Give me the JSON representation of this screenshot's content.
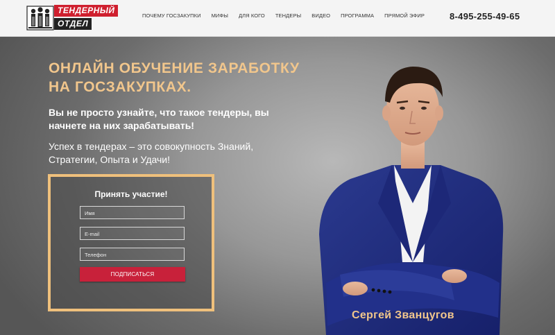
{
  "header": {
    "logo": {
      "line1": "ТЕНДЕРНЫЙ",
      "line2": "ОТДЕЛ",
      "icon": "people-building-icon"
    },
    "nav": [
      {
        "label": "ПОЧЕМУ ГОСЗАКУПКИ"
      },
      {
        "label": "МИФЫ"
      },
      {
        "label": "ДЛЯ КОГО"
      },
      {
        "label": "ТЕНДЕРЫ"
      },
      {
        "label": "ВИДЕО"
      },
      {
        "label": "ПРОГРАММА"
      },
      {
        "label": "ПРЯМОЙ ЭФИР"
      }
    ],
    "phone": "8-495-255-49-65"
  },
  "hero": {
    "title": "ОНЛАЙН ОБУЧЕНИЕ ЗАРАБОТКУ НА ГОСЗАКУПКАХ.",
    "lead": "Вы не просто узнайте, что такое тендеры, вы начнете на них зарабатывать!",
    "sub": "Успех в тендерах – это совокупность Знаний, Стратегии, Опыта и Удачи!",
    "form": {
      "title": "Принять участие!",
      "name_placeholder": "Имя",
      "email_placeholder": "E-mail",
      "phone_placeholder": "Телефон",
      "submit_label": "ПОДПИСАТЬСЯ"
    },
    "person_name": "Сергей Званцугов"
  },
  "colors": {
    "accent_gold": "#f1c68c",
    "brand_red": "#cf1f2e",
    "button_red": "#c8213a"
  }
}
